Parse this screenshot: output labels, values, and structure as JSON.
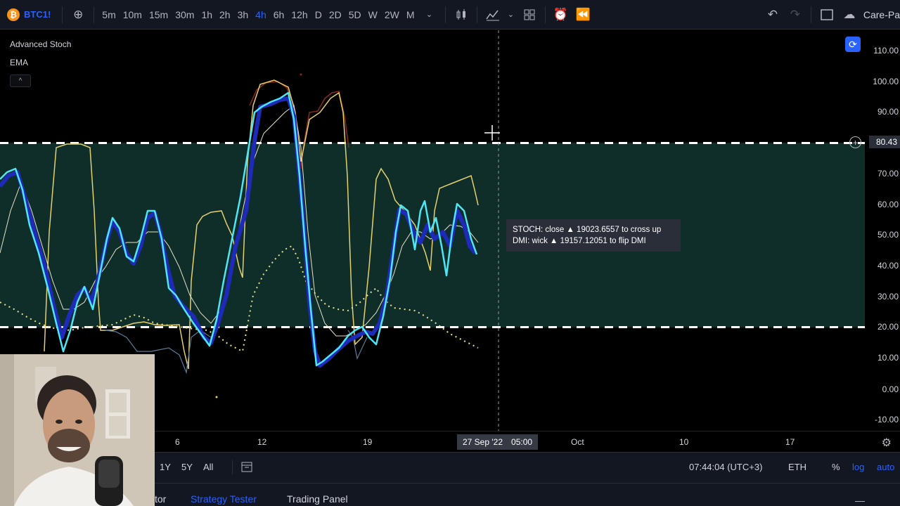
{
  "toolbar": {
    "symbol": "BTC1!",
    "symbol_icon": "bitcoin-icon",
    "intervals": [
      "5m",
      "10m",
      "15m",
      "30m",
      "1h",
      "2h",
      "3h",
      "4h",
      "6h",
      "12h",
      "D",
      "2D",
      "5D",
      "W",
      "2W",
      "M"
    ],
    "active_interval": "4h",
    "right_label": "Care-Pa"
  },
  "legend": {
    "indicator": "Advanced Stoch",
    "ema": "EMA",
    "collapse_glyph": "^"
  },
  "price_scale": {
    "labels": [
      "110.00",
      "100.00",
      "90.00",
      "80.43",
      "70.00",
      "60.00",
      "50.00",
      "40.00",
      "30.00",
      "20.00",
      "10.00",
      "0.00",
      "-10.00"
    ],
    "current": "80.43"
  },
  "time_scale": {
    "labels": [
      "6",
      "12",
      "19",
      "Oct",
      "10",
      "17"
    ],
    "hover_date": "27 Sep '22",
    "hover_time": "05:00"
  },
  "tooltip": {
    "line1": "STOCH: close ▲ 19023.6557 to cross up",
    "line2": "DMI: wick ▲ 19157.12051 to flip DMI"
  },
  "range_bar": {
    "ranges": [
      "1Y",
      "5Y",
      "All"
    ],
    "clock": "07:44:04 (UTC+3)",
    "symbol": "ETH",
    "percent": "%",
    "log": "log",
    "auto": "auto"
  },
  "bottom_tabs": {
    "partial": "tor",
    "strategy_tester": "Strategy Tester",
    "trading_panel": "Trading Panel"
  },
  "colors": {
    "accent": "#2962ff",
    "zone": "#0f2e2a",
    "stoch_k": "#1e2ab8",
    "stoch_d": "#4ee6f5",
    "ema": "#e6d06c",
    "dmi_red": "#8a2a1e",
    "dotted": "#e8e38a"
  }
}
